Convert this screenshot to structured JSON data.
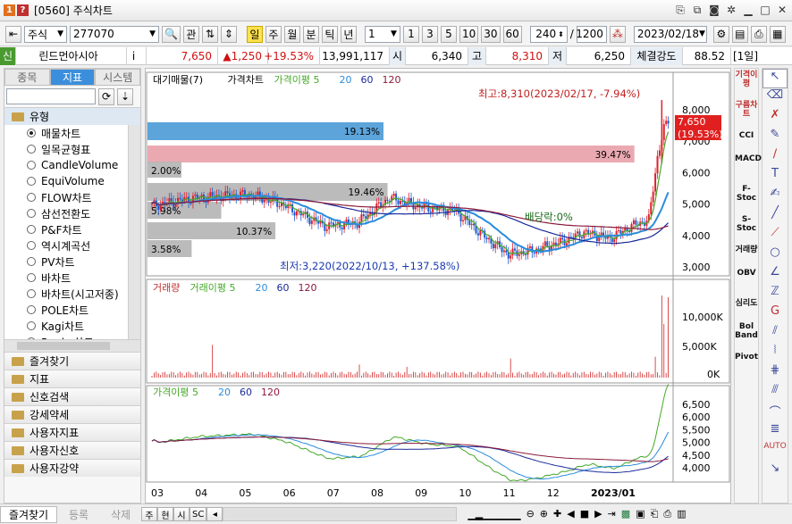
{
  "window": {
    "badge1": "1",
    "badge2": "?",
    "title": "[0560] 주식차트"
  },
  "toolbar": {
    "market": "주식",
    "code": "277070",
    "btn_kwan": "관",
    "periods": [
      "일",
      "주",
      "월",
      "분",
      "틱",
      "년"
    ],
    "numbox": "1",
    "nums": [
      "1",
      "3",
      "5",
      "10",
      "30",
      "60"
    ],
    "count": "240",
    "slash": "/",
    "total": "1200",
    "date": "2023/02/18"
  },
  "info": {
    "sin": "신",
    "name": "린드먼아시아",
    "i": "i",
    "price": "7,650",
    "change": "▲1,250",
    "pct": "+19.53%",
    "volume": "13,991,117",
    "open_lbl": "시",
    "open": "6,340",
    "high_lbl": "고",
    "high": "8,310",
    "low_lbl": "저",
    "low": "6,250",
    "str_lbl": "체결강도",
    "strength": "88.52",
    "period": "[1일]"
  },
  "leftpane": {
    "tabs": [
      "종목",
      "지표",
      "시스템"
    ],
    "group": "유형",
    "items": [
      "매물차트",
      "일목균형표",
      "CandleVolume",
      "EquiVolume",
      "FLOW차트",
      "삼선전환도",
      "P&F차트",
      "역시계곡선",
      "PV차트",
      "바차트",
      "바차트(시고저종)",
      "POLE차트",
      "Kagi차트",
      "Renko차트"
    ],
    "folders": [
      "즐겨찾기",
      "지표",
      "신호검색",
      "강세약세",
      "사용자지표",
      "사용자신호",
      "사용자강약"
    ],
    "bottom_tabs": [
      "즐겨찾기",
      "등록",
      "삭제"
    ]
  },
  "chart": {
    "legend_price": [
      "대기매물(7)",
      "가격차트",
      "가격이평 5",
      "20",
      "60",
      "120"
    ],
    "legend_volume": [
      "거래량",
      "거래이평 5",
      "20",
      "60",
      "120"
    ],
    "legend_ma": [
      "가격이평 5",
      "20",
      "60",
      "120"
    ],
    "high_note": "최고:8,310(2023/02/17, -7.94%)",
    "low_note": "최저:3,220(2022/10/13, +137.58%)",
    "div_note": "배당락:0%",
    "cur_price": "7,650",
    "cur_pct": "(19.53%)",
    "price_axis": [
      "8,000",
      "7,000",
      "6,000",
      "5,000",
      "4,000",
      "3,000"
    ],
    "vol_axis": [
      "10,000K",
      "5,000K",
      "0K"
    ],
    "ma_axis": [
      "6,500",
      "6,000",
      "5,500",
      "5,000",
      "4,500",
      "4,000"
    ],
    "x_labels": [
      "03",
      "04",
      "05",
      "06",
      "07",
      "08",
      "09",
      "10",
      "11",
      "12",
      "2023/01"
    ],
    "profile": [
      {
        "pct": "19.13%",
        "frac": 0.1913
      },
      {
        "pct": "39.47%",
        "frac": 0.3947
      },
      {
        "pct": "2.00%",
        "frac": 0.02
      },
      {
        "pct": "19.46%",
        "frac": 0.1946
      },
      {
        "pct": "5.98%",
        "frac": 0.0598
      },
      {
        "pct": "10.37%",
        "frac": 0.1037
      },
      {
        "pct": "3.58%",
        "frac": 0.0358
      }
    ],
    "colors": {
      "price_up": "#e0202a",
      "ma5": "#44a828",
      "ma20": "#2a8cdc",
      "ma60": "#1a2a9a",
      "ma120": "#8a1a3a",
      "profile_hi": "#4a9ad6",
      "profile_red": "#e8a0a8",
      "profile_gray": "#b4b4b4"
    }
  },
  "rightbar": [
    "기격이평",
    "구름차트",
    "CCI",
    "MACD",
    "F-Stoc",
    "S-Stoc",
    "거래량",
    "OBV",
    "심리도",
    "Bol Band",
    "Pivot"
  ],
  "bottom": {
    "tabs": [
      "주",
      "현",
      "시",
      "SC"
    ]
  }
}
